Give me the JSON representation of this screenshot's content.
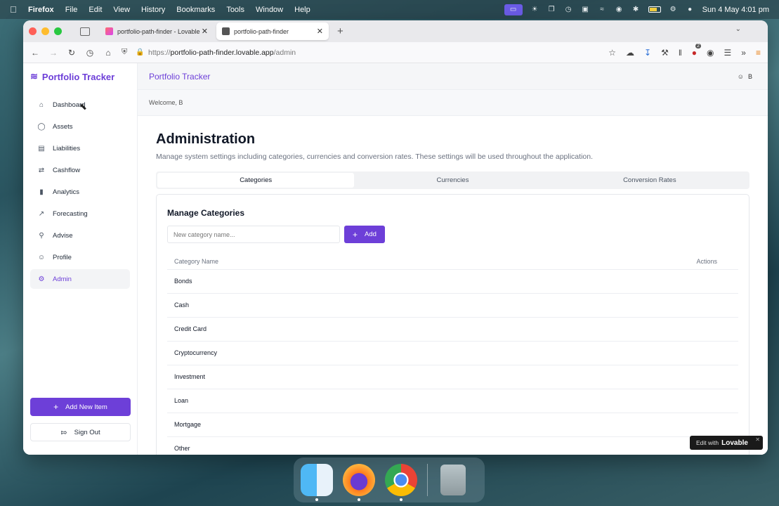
{
  "menubar": {
    "app": "Firefox",
    "items": [
      "File",
      "Edit",
      "View",
      "History",
      "Bookmarks",
      "Tools",
      "Window",
      "Help"
    ],
    "clock": "Sun 4 May  4:01 pm"
  },
  "browser": {
    "tabs": [
      {
        "title": "portfolio-path-finder - Lovable"
      },
      {
        "title": "portfolio-path-finder"
      }
    ],
    "url": {
      "protocol": "https://",
      "host": "portfolio-path-finder.lovable.app",
      "path": "/admin"
    }
  },
  "sidebar": {
    "brand": "Portfolio Tracker",
    "items": [
      {
        "label": "Dashboard",
        "icon": "home-icon"
      },
      {
        "label": "Assets",
        "icon": "assets-icon"
      },
      {
        "label": "Liabilities",
        "icon": "card-icon"
      },
      {
        "label": "Cashflow",
        "icon": "arrows-icon"
      },
      {
        "label": "Analytics",
        "icon": "chart-icon"
      },
      {
        "label": "Forecasting",
        "icon": "trend-icon"
      },
      {
        "label": "Advise",
        "icon": "bulb-icon"
      },
      {
        "label": "Profile",
        "icon": "user-icon"
      },
      {
        "label": "Admin",
        "icon": "gear-icon",
        "active": true
      }
    ],
    "add_new_label": "Add New Item",
    "sign_out_label": "Sign Out"
  },
  "header": {
    "title": "Portfolio Tracker",
    "user_initial": "B",
    "welcome": "Welcome, B"
  },
  "page": {
    "title": "Administration",
    "description": "Manage system settings including categories, currencies and conversion rates. These settings will be used throughout the application.",
    "tabs": [
      "Categories",
      "Currencies",
      "Conversion Rates"
    ],
    "active_tab": "Categories"
  },
  "categories": {
    "heading": "Manage Categories",
    "input_placeholder": "New category name...",
    "add_label": "Add",
    "columns": [
      "Category Name",
      "Actions"
    ],
    "rows": [
      "Bonds",
      "Cash",
      "Credit Card",
      "Cryptocurrency",
      "Investment",
      "Loan",
      "Mortgage",
      "Other"
    ]
  },
  "lovable_badge": {
    "prefix": "Edit with",
    "brand": "Lovable"
  },
  "colors": {
    "accent": "#6d3fd8"
  }
}
